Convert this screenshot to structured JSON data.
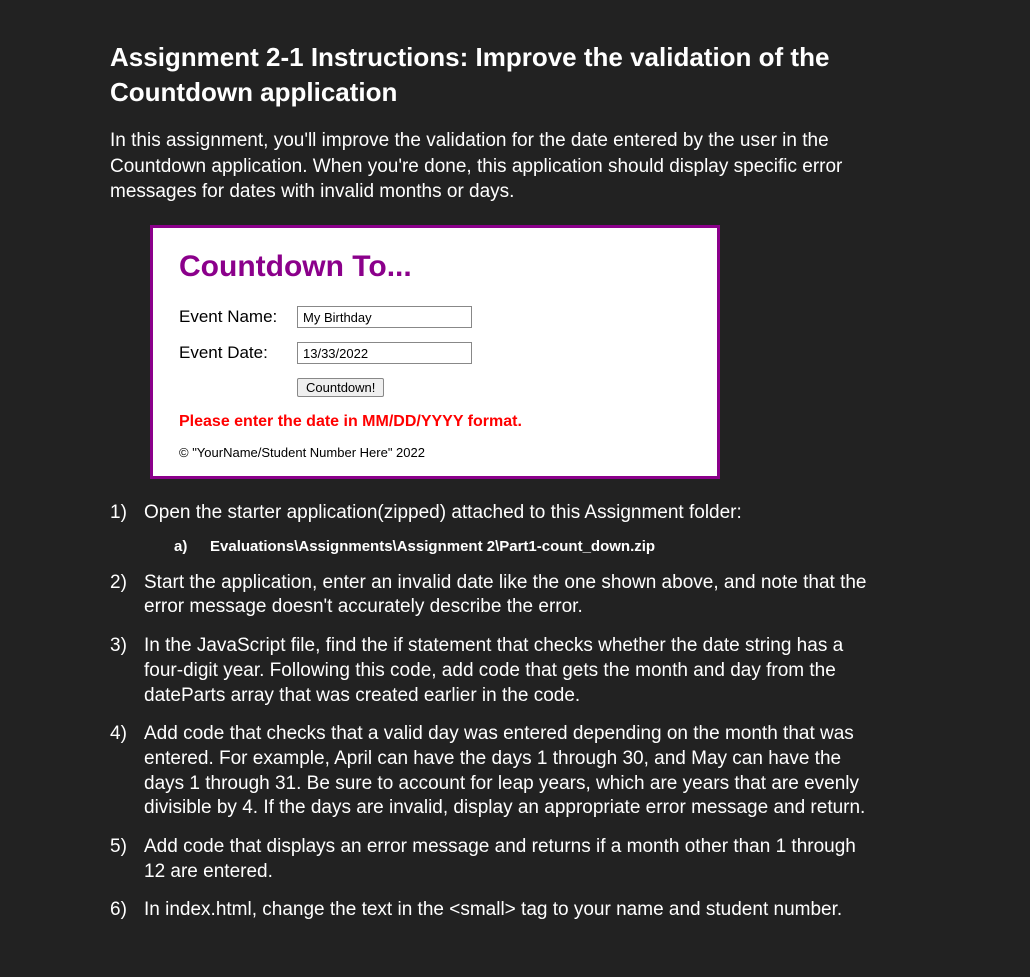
{
  "heading": "Assignment 2-1 Instructions: Improve the validation of the Countdown application",
  "intro": "In this assignment, you'll improve the validation for the date entered by the user in the Countdown application. When you're done, this application should display specific error messages for dates with invalid months or days.",
  "app": {
    "title": "Countdown To...",
    "eventNameLabel": "Event Name:",
    "eventNameValue": "My Birthday",
    "eventDateLabel": "Event Date:",
    "eventDateValue": "13/33/2022",
    "buttonLabel": "Countdown!",
    "errorMessage": "Please enter the date in MM/DD/YYYY format.",
    "footer": "© \"YourName/Student Number Here\" 2022"
  },
  "steps": {
    "s1": "Open the starter application(zipped) attached to this Assignment folder:",
    "s1a": "Evaluations\\Assignments\\Assignment 2\\Part1-count_down.zip",
    "s2": "Start the application, enter an invalid date like the one shown above, and note that the error message doesn't accurately describe the error.",
    "s3": "In the JavaScript file, find the if statement that checks whether the date string has a four-digit year. Following this code, add code that gets the month and day from the dateParts array that was created earlier in the code.",
    "s4": "Add code that checks that a valid day was entered depending on the month that was entered. For example, April can have the days 1 through 30, and May can have the days 1 through 31. Be sure to account for leap years, which are years that are evenly divisible by 4. If the days are invalid, display an appropriate error message and return.",
    "s5": "Add code that displays an error message and returns if a month other than 1 through 12 are entered.",
    "s6": "In index.html, change the text in the <small> tag to your name and student number."
  }
}
